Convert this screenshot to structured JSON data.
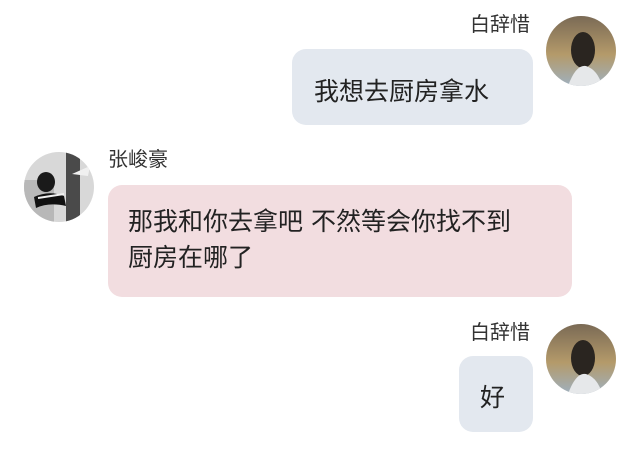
{
  "chat": {
    "messages": [
      {
        "sender": "白辞惜",
        "direction": "outgoing",
        "text": "我想去厨房拿水"
      },
      {
        "sender": "张峻豪",
        "direction": "incoming",
        "text_lines": [
          "那我和你去拿吧 不然等会你找不到",
          "厨房在哪了"
        ]
      },
      {
        "sender": "白辞惜",
        "direction": "outgoing",
        "text": "好"
      }
    ]
  },
  "colors": {
    "outgoing_bubble": "#e3e8ef",
    "incoming_bubble": "#f2dde0",
    "text": "#222222",
    "name": "#333333"
  }
}
